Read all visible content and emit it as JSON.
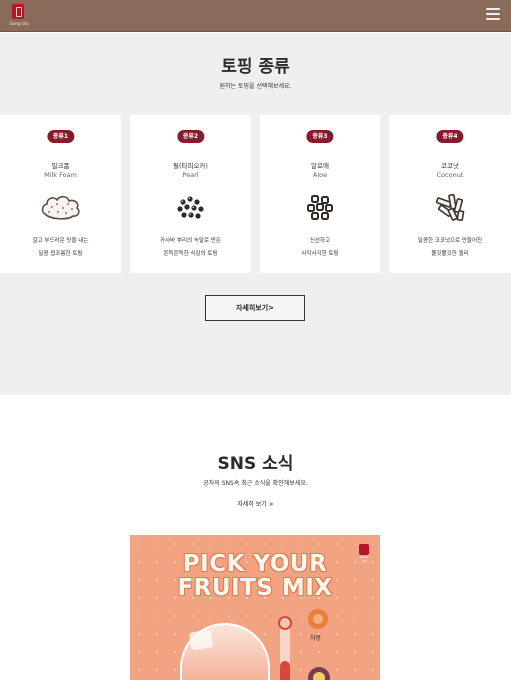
{
  "header": {
    "logo_text": "Gong cha",
    "menu_icon": "hamburger-menu-icon"
  },
  "topping": {
    "title": "토핑 종류",
    "subtitle": "원하는 토핑을 선택해보세요.",
    "more_label": "자세히보기>",
    "cards": [
      {
        "badge": "종류1",
        "name_ko": "밀크폼",
        "name_en": "Milk Foam",
        "icon": "milk-foam-icon",
        "desc": [
          "갈고 부드러운 맛을 내는",
          "달콤 짭조름한 토핑"
        ]
      },
      {
        "badge": "종류2",
        "name_ko": "펄(타피오카)",
        "name_en": "Pearl",
        "icon": "pearl-icon",
        "desc": [
          "카사바 뿌리의 녹말로 만든",
          "쫀득쫀득한 식감의 토핑"
        ]
      },
      {
        "badge": "종류3",
        "name_ko": "알로에",
        "name_en": "Aloe",
        "icon": "aloe-icon",
        "desc": [
          "신선하고",
          "사각사각한 토핑"
        ]
      },
      {
        "badge": "종류4",
        "name_ko": "코코넛",
        "name_en": "Coconut",
        "icon": "coconut-icon",
        "desc": [
          "달콤한 코코넛으로 만들어진",
          "쫄깃쫄깃한 젤리"
        ]
      }
    ]
  },
  "sns": {
    "title": "SNS 소식",
    "subtitle": "공차의 SNS속 최근 소식을 확인해보세요.",
    "more_label": "자세히 보기 >",
    "post": {
      "headline_1": "PICK YOUR",
      "headline_2": "FRUITS MIX",
      "fruit_label": "자몽",
      "logo_text": "Gong cha"
    }
  },
  "colors": {
    "header_bg": "#8a6b5a",
    "badge_bg": "#861c2b",
    "section_bg": "#efefef",
    "post_bg": "#f1a382"
  }
}
